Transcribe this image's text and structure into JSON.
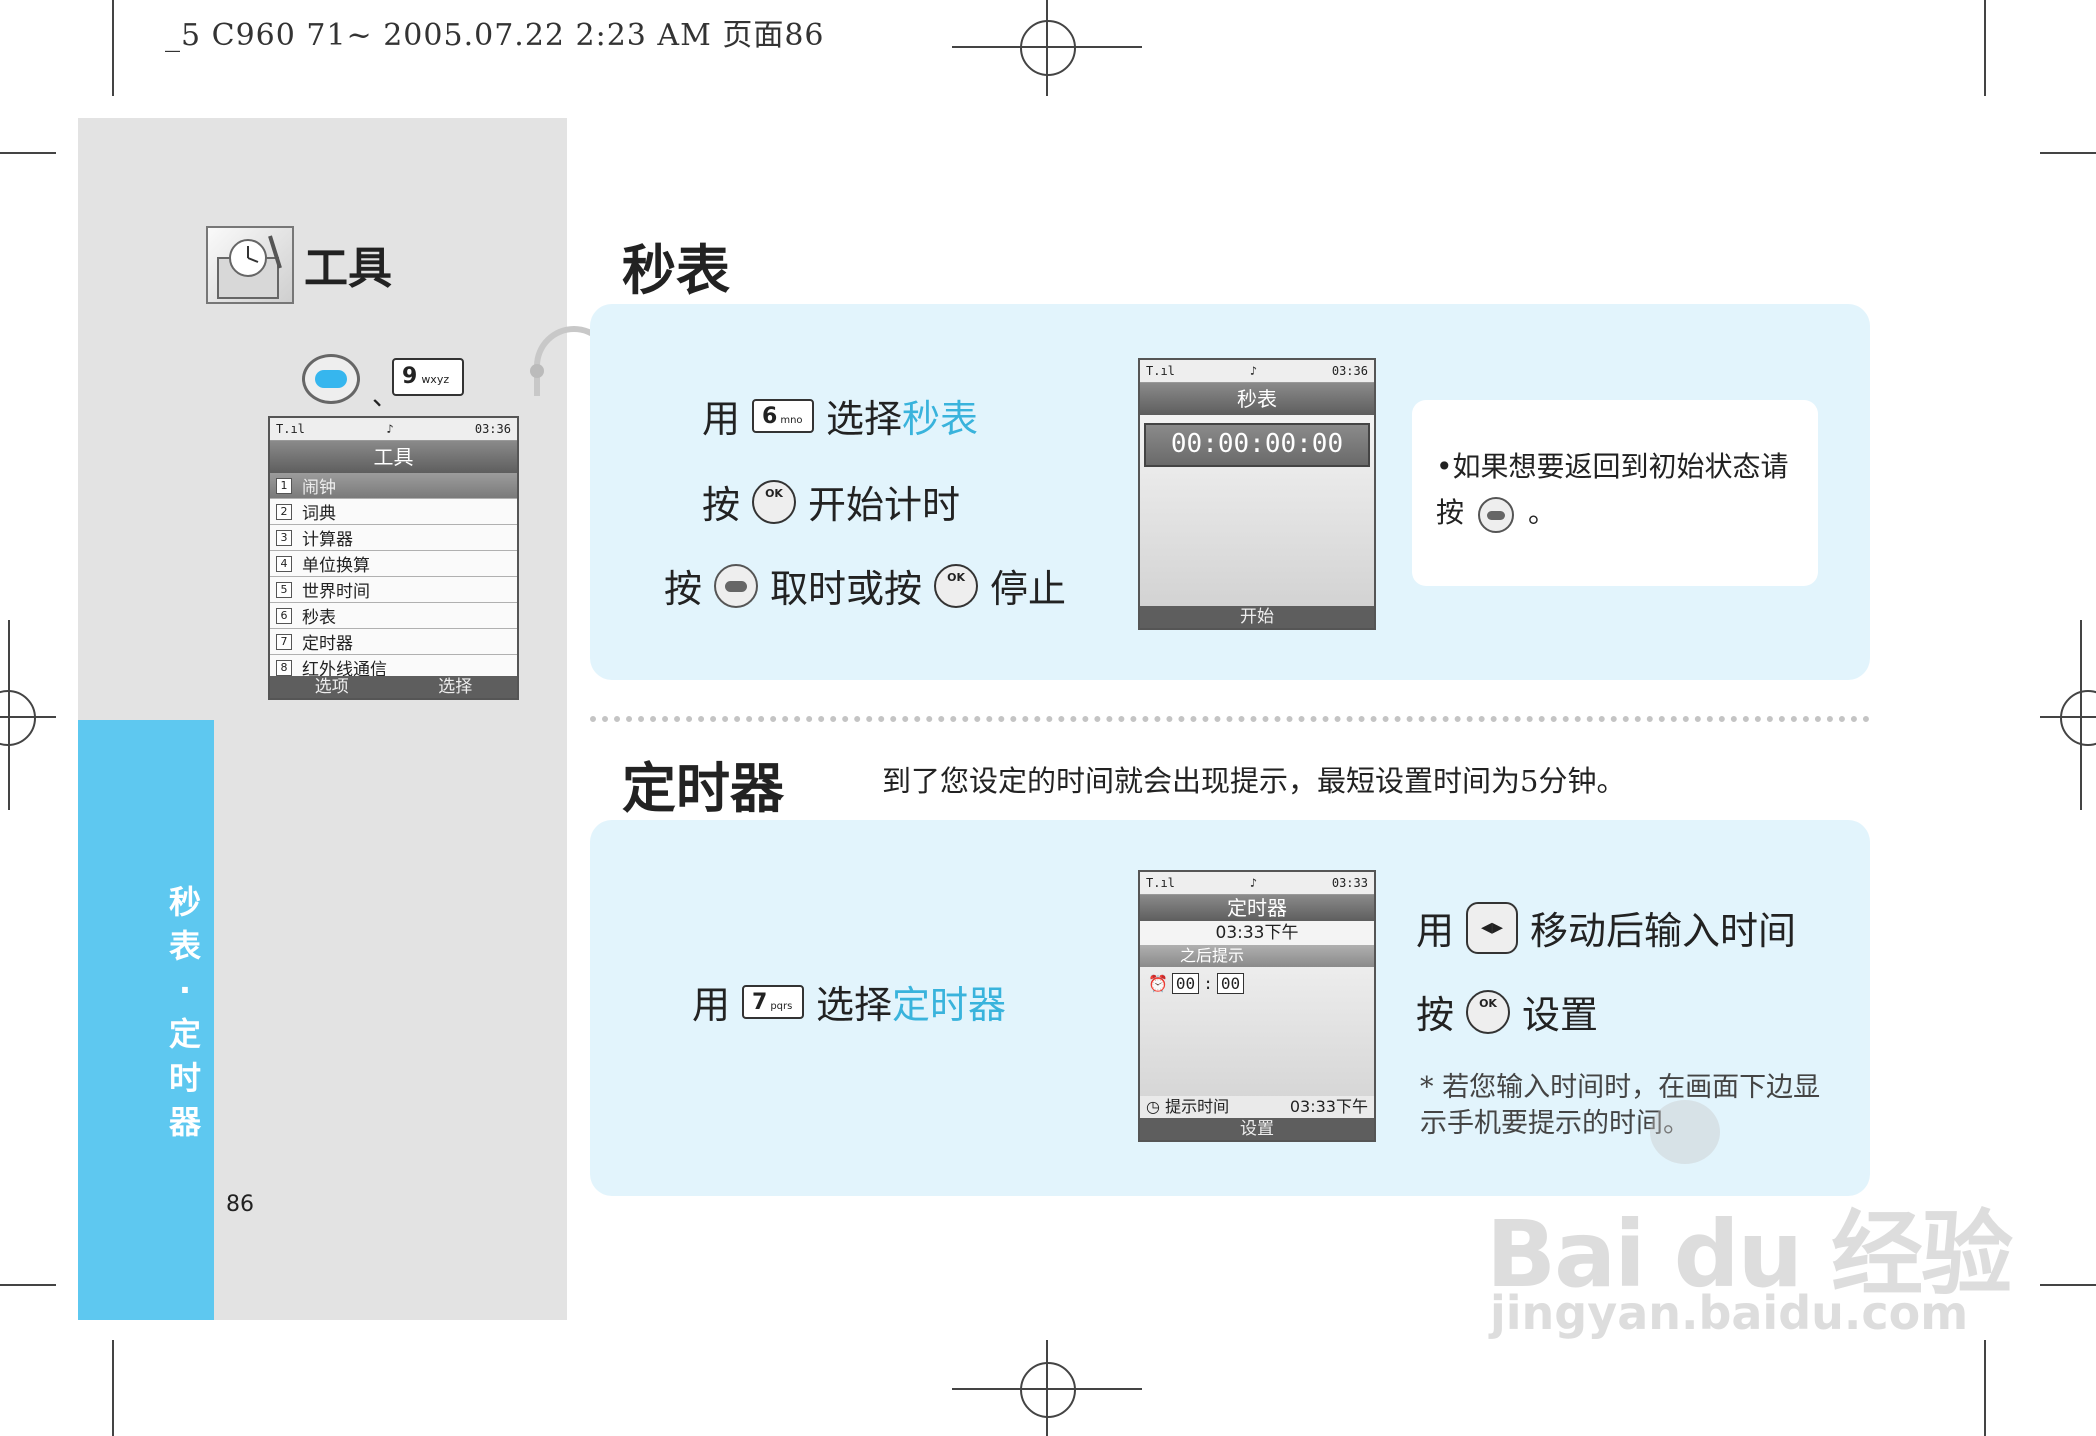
{
  "print_header": "_5 C960 71~  2005.07.22  2:23  AM  页面86",
  "sidebar": {
    "section_title": "工具",
    "key_label": "9",
    "key_letters": "wxyz",
    "separator": "、",
    "vertical_label": [
      "秒",
      "表",
      "·",
      "定",
      "时",
      "器"
    ],
    "page_number": "86"
  },
  "menu_phone": {
    "status_time": "03:36",
    "title": "工具",
    "items": [
      {
        "num": "1",
        "label": "闹钟"
      },
      {
        "num": "2",
        "label": "词典"
      },
      {
        "num": "3",
        "label": "计算器"
      },
      {
        "num": "4",
        "label": "单位换算"
      },
      {
        "num": "5",
        "label": "世界时间"
      },
      {
        "num": "6",
        "label": "秒表"
      },
      {
        "num": "7",
        "label": "定时器"
      },
      {
        "num": "8",
        "label": "红外线通信"
      }
    ],
    "soft_left": "选项",
    "soft_right": "选择"
  },
  "stopwatch": {
    "title": "秒表",
    "line1_prefix": "用",
    "line1_key": "6",
    "line1_key_letters": "mno",
    "line1_mid": "选择",
    "line1_highlight": "秒表",
    "line2_prefix": "按",
    "line2_text": "开始计时",
    "line3_prefix": "按",
    "line3_mid": "取时或按",
    "line3_suffix": "停止",
    "ok_label": "OK",
    "phone": {
      "status_time": "03:36",
      "title": "秒表",
      "display": "00:00:00:00",
      "soft_center": "开始"
    },
    "note_line1": "•如果想要返回到初始状态请",
    "note_line2_prefix": "按",
    "note_line2_suffix": "。"
  },
  "timer": {
    "title": "定时器",
    "description": "到了您设定的时间就会出现提示，最短设置时间为5分钟。",
    "line1_prefix": "用",
    "line1_key": "7",
    "line1_key_letters": "pqrs",
    "line1_mid": "选择",
    "line1_highlight": "定时器",
    "right1_prefix": "用",
    "right1_text": "移动后输入时间",
    "right2_prefix": "按",
    "right2_text": "设置",
    "star_note": "* 若您输入时间时，在画面下边显示手机要提示的时间。",
    "phone": {
      "status_time": "03:33",
      "title": "定时器",
      "time": "03:33下午",
      "subheader": "之后提示",
      "hours": "00",
      "colon": ":",
      "minutes": "00",
      "footer_label": "提示时间",
      "footer_time": "03:33下午",
      "soft_center": "设置"
    }
  },
  "watermark": {
    "brand": "Bai du 经验",
    "url": "jingyan.baidu.com"
  }
}
